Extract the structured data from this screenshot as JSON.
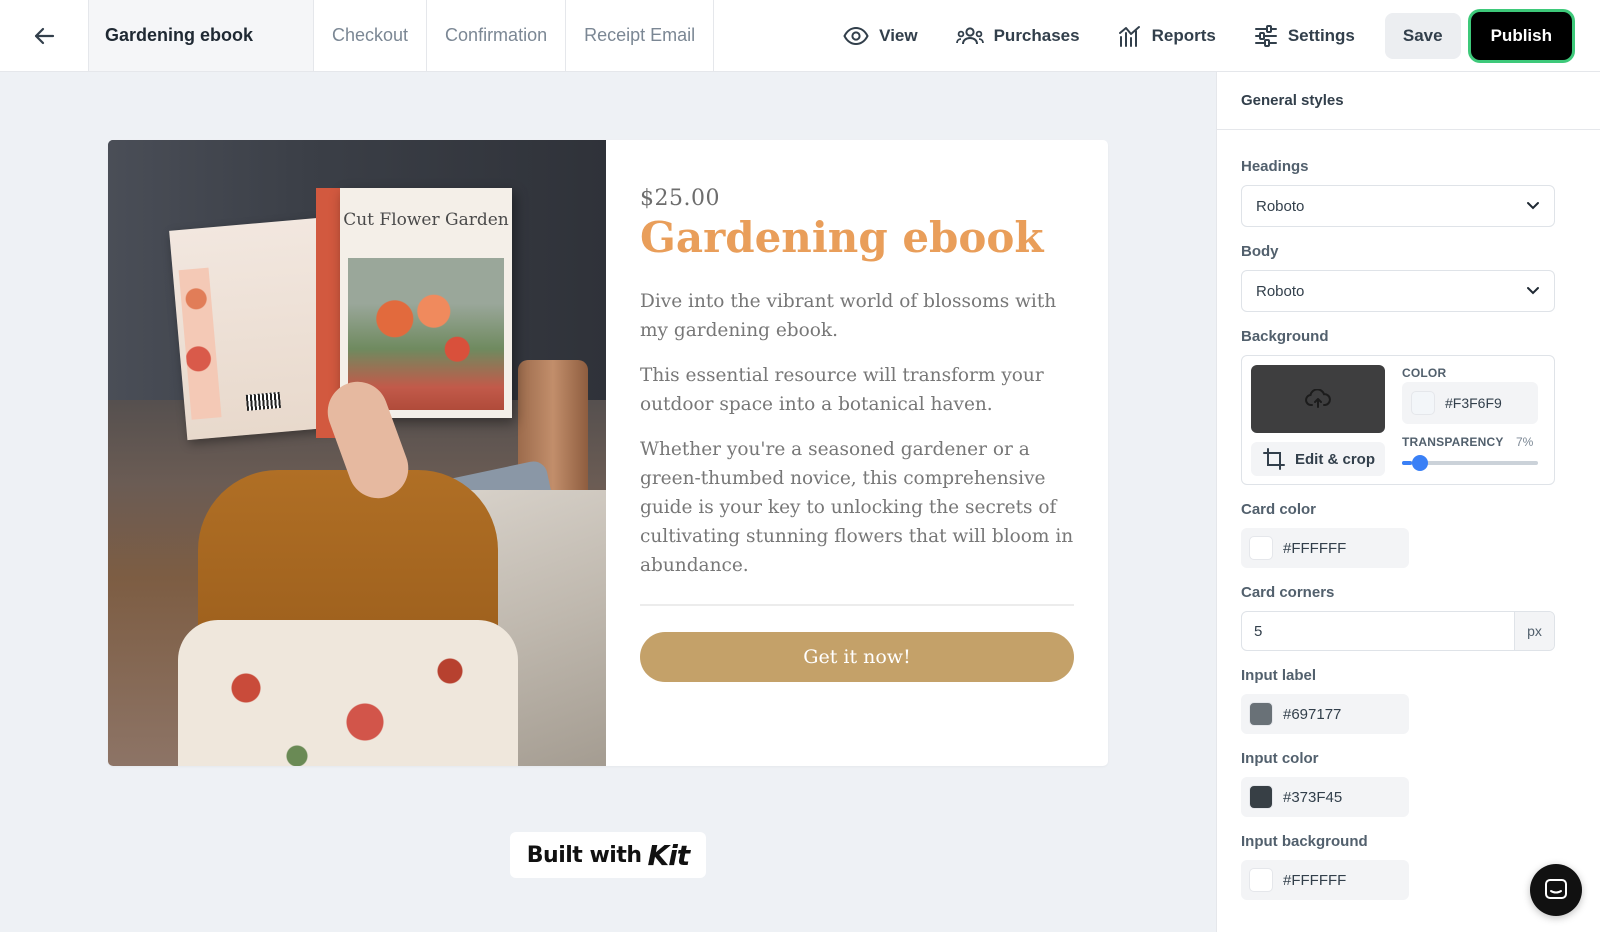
{
  "topbar": {
    "active_tab": "Gardening ebook",
    "tabs": [
      "Checkout",
      "Confirmation",
      "Receipt Email"
    ],
    "view_label": "View",
    "purchases_label": "Purchases",
    "reports_label": "Reports",
    "settings_label": "Settings",
    "save_label": "Save",
    "publish_label": "Publish"
  },
  "card": {
    "price": "$25.00",
    "title": "Gardening ebook",
    "paragraphs": [
      "Dive into the vibrant world of blossoms with my gardening ebook.",
      "This essential resource will transform your outdoor space into a botanical haven.",
      "Whether you're a seasoned gardener or a green-thumbed novice, this comprehensive guide is your key to unlocking the secrets of cultivating stunning flowers that will bloom in abundance."
    ],
    "cta_label": "Get it now!",
    "book_cover_title": "Cut Flower Garden",
    "accent_color": "#E99E5A",
    "button_color": "#C4A169"
  },
  "footer_badge": {
    "text": "Built with",
    "logo": "Kit"
  },
  "sidebar": {
    "header": "General styles",
    "headings_label": "Headings",
    "headings_font": "Roboto",
    "body_label": "Body",
    "body_font": "Roboto",
    "background_label": "Background",
    "edit_crop_label": "Edit & crop",
    "color_label": "COLOR",
    "bg_color": "#F3F6F9",
    "transparency_label": "TRANSPARENCY",
    "transparency_value": "7%",
    "transparency_fraction": 0.07,
    "card_color_label": "Card color",
    "card_color": "#FFFFFF",
    "card_corners_label": "Card corners",
    "card_corners_value": "5",
    "card_corners_unit": "px",
    "input_label_label": "Input label",
    "input_label_color": "#697177",
    "input_color_label": "Input color",
    "input_color": "#373F45",
    "input_background_label": "Input background",
    "input_background": "#FFFFFF"
  }
}
